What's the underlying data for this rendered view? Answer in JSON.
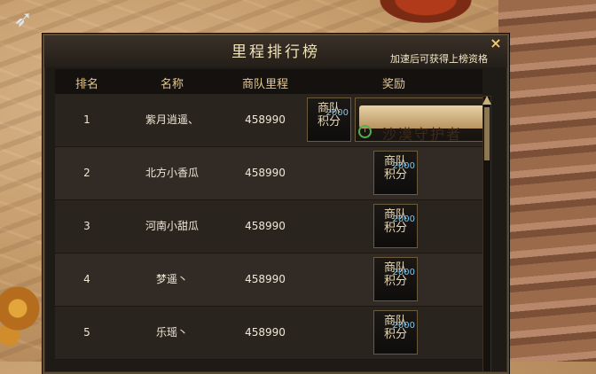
{
  "panel": {
    "title": "里程排行榜",
    "close_symbol": "×",
    "hint": "加速后可获得上榜资格"
  },
  "columns": [
    "排名",
    "名称",
    "商队里程",
    "奖励"
  ],
  "rows": [
    {
      "rank": "1",
      "name": "紫月逍遥、",
      "distance": "458990",
      "reward": {
        "line1": "商队",
        "line2": "积分",
        "amount": "2000",
        "title": "沙漠守护者"
      }
    },
    {
      "rank": "2",
      "name": "北方小香瓜",
      "distance": "458990",
      "reward": {
        "line1": "商队",
        "line2": "积分",
        "amount": "2000"
      }
    },
    {
      "rank": "3",
      "name": "河南小甜瓜",
      "distance": "458990",
      "reward": {
        "line1": "商队",
        "line2": "积分",
        "amount": "2000"
      }
    },
    {
      "rank": "4",
      "name": "梦遥丶",
      "distance": "458990",
      "reward": {
        "line1": "商队",
        "line2": "积分",
        "amount": "2000"
      }
    },
    {
      "rank": "5",
      "name": "乐瑶丶",
      "distance": "458990",
      "reward": {
        "line1": "商队",
        "line2": "积分",
        "amount": "2000"
      }
    }
  ],
  "icons": {
    "close": "close-icon",
    "clock": "clock-icon",
    "scroll_up": "scroll-up-icon"
  }
}
